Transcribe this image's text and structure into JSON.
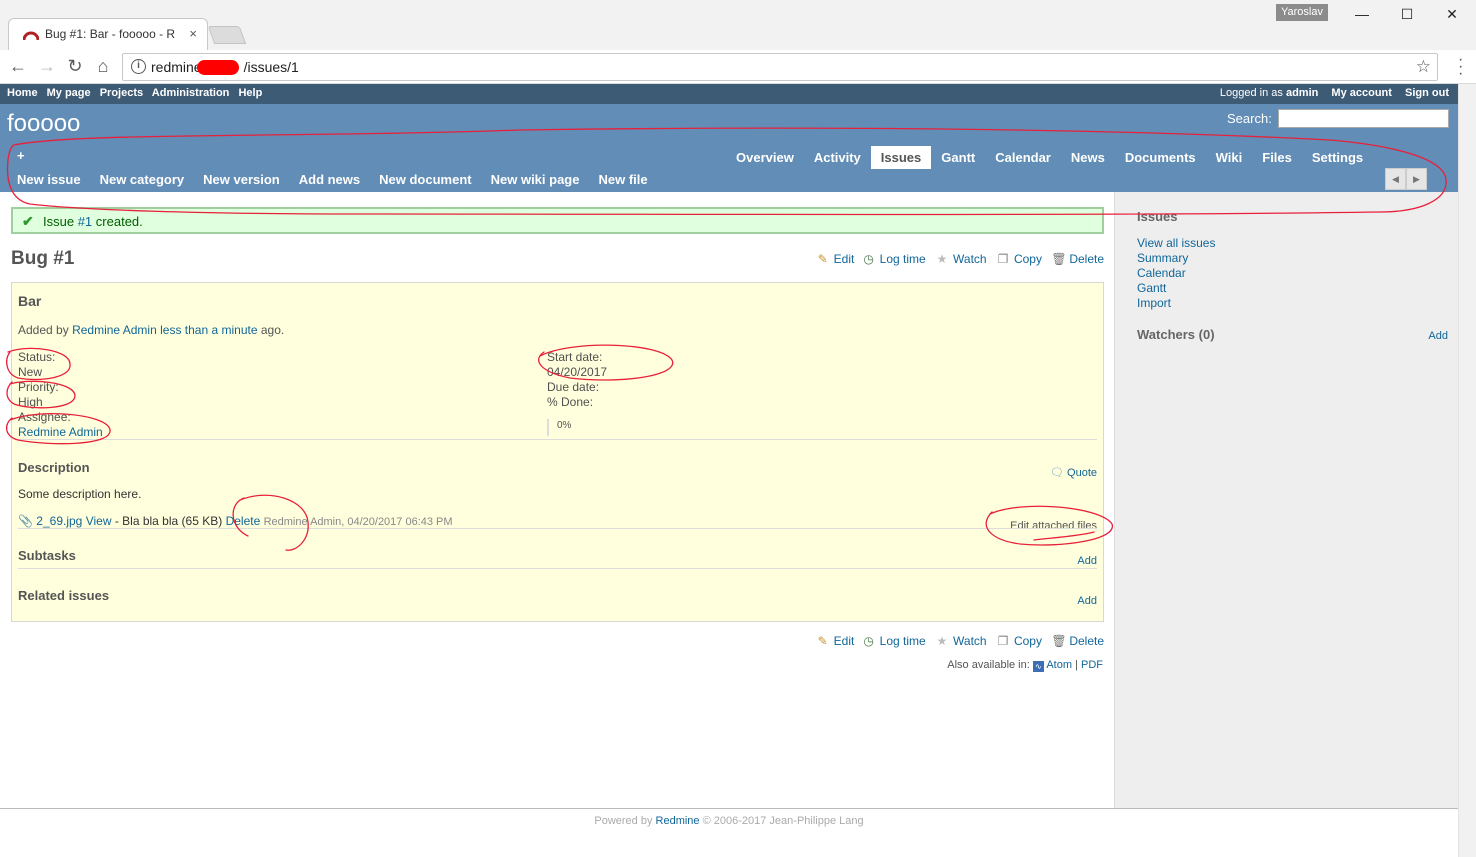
{
  "browser": {
    "tab_title": "Bug #1: Bar - fooooo - R",
    "tab_close": "×",
    "profile_name": "Yaroslav",
    "url_prefix": "redmine",
    "url_suffix": "/issues/1"
  },
  "top_menu": {
    "left_items": [
      "Home",
      "My page",
      "Projects",
      "Administration",
      "Help"
    ],
    "logged_in_prefix": "Logged in as",
    "logged_in_user": "admin",
    "my_account": "My account",
    "sign_out": "Sign out"
  },
  "header": {
    "project_title": "fooooo",
    "search_label": "Search:",
    "plus": "+",
    "new_menu": [
      "New issue",
      "New category",
      "New version",
      "Add news",
      "New document",
      "New wiki page",
      "New file"
    ],
    "main_menu": [
      "Overview",
      "Activity",
      "Issues",
      "Gantt",
      "Calendar",
      "News",
      "Documents",
      "Wiki",
      "Files",
      "Settings"
    ],
    "selected_tab": "Issues"
  },
  "flash": {
    "prefix": "Issue",
    "link": "#1",
    "suffix": "created."
  },
  "issue": {
    "heading": "Bug #1",
    "actions": [
      "Edit",
      "Log time",
      "Watch",
      "Copy",
      "Delete"
    ],
    "subject": "Bar",
    "added_by": "Added by",
    "author": "Redmine Admin",
    "time_ago": "less than a minute",
    "ago": "ago.",
    "status_label": "Status:",
    "status_value": "New",
    "priority_label": "Priority:",
    "priority_value": "High",
    "assignee_label": "Assignee:",
    "assignee_value": "Redmine Admin",
    "start_date_label": "Start date:",
    "start_date_value": "04/20/2017",
    "due_date_label": "Due date:",
    "done_label": "% Done:",
    "done_value": "0%",
    "done_ratio": 0,
    "description_title": "Description",
    "quote": "Quote",
    "description_text": "Some description here.",
    "attachment_name": "2_69.jpg",
    "attachment_view": "View",
    "attachment_desc": "- Bla bla bla (65 KB)",
    "attachment_delete": "Delete",
    "attachment_meta": "Redmine Admin, 04/20/2017 06:43 PM",
    "edit_attached": "Edit attached files",
    "subtasks_title": "Subtasks",
    "subtasks_add": "Add",
    "related_title": "Related issues",
    "related_add": "Add",
    "also_available": "Also available in:",
    "atom": "Atom",
    "pdf": "PDF",
    "separator": "|"
  },
  "sidebar": {
    "issues_title": "Issues",
    "links": [
      "View all issues",
      "Summary",
      "Calendar",
      "Gantt",
      "Import"
    ],
    "watchers_title": "Watchers (0)",
    "watchers_add": "Add"
  },
  "footer": {
    "powered_by": "Powered by",
    "redmine": "Redmine",
    "copyright": "© 2006-2017 Jean-Philippe Lang"
  },
  "colors": {
    "top_menu_bg": "#3e5b76",
    "header_bg": "#628db6",
    "link": "#116699",
    "issue_bg": "#ffffdd",
    "flash_bg": "#dfffdf",
    "annotation": "#e8203a"
  }
}
